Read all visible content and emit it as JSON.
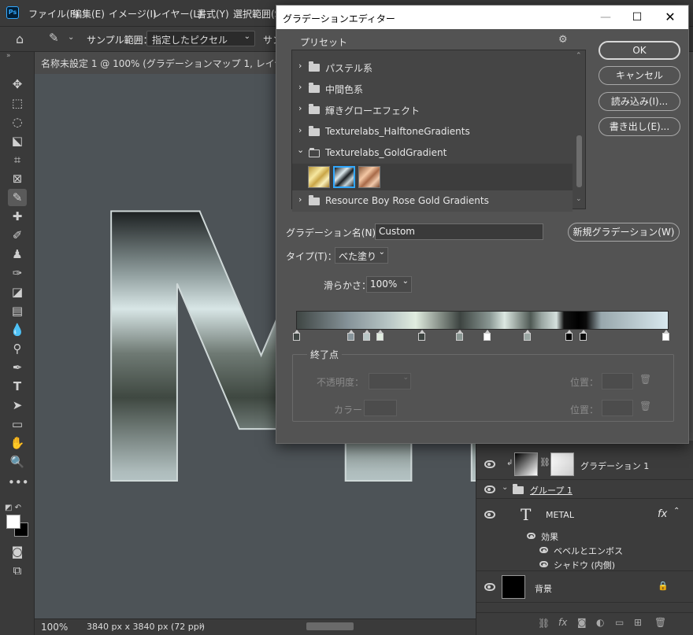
{
  "app": {
    "logo": "Ps",
    "menu": [
      "ファイル(F)",
      "編集(E)",
      "イメージ(I)",
      "レイヤー(L)",
      "書式(Y)",
      "選択範囲(S"
    ]
  },
  "options_bar": {
    "sample_label": "サンプル範囲：",
    "sample_value": "指定したピクセル",
    "trailing": "サン"
  },
  "document": {
    "tab_title": "名称未設定 1 @ 100% (グラデーションマップ 1, レイヤーマスク/16)",
    "canvas_text": "METAL",
    "zoom": "100%",
    "size_info": "3840 px x 3840 px (72 ppi)",
    "status_arrow": "›"
  },
  "dialog": {
    "title": "グラデーションエディター",
    "preset_label": "プリセット",
    "presets": [
      {
        "name": "パステル系",
        "expanded": false
      },
      {
        "name": "中間色系",
        "expanded": false
      },
      {
        "name": "輝きグローエフェクト",
        "expanded": false
      },
      {
        "name": "Texturelabs_HalftoneGradients",
        "expanded": false
      },
      {
        "name": "Texturelabs_GoldGradient",
        "expanded": true
      },
      {
        "name": "Resource Boy Rose Gold Gradients",
        "expanded": false
      }
    ],
    "buttons": {
      "ok": "OK",
      "cancel": "キャンセル",
      "load": "読み込み(I)...",
      "save": "書き出し(E)...",
      "new_gradient": "新規グラデーション(W)"
    },
    "gradient_name_label": "グラデーション名(N)：",
    "gradient_name_value": "Custom",
    "type_label": "タイプ(T)：",
    "type_value": "べた塗り",
    "smoothness_label": "滑らかさ：",
    "smoothness_value": "100%",
    "stops_group_label": "終了点",
    "opacity_label": "不透明度：",
    "color_label": "カラー：",
    "location_label": "位置："
  },
  "layers": {
    "rows": [
      {
        "name": "グラデーション 1"
      },
      {
        "name": "グループ 1"
      },
      {
        "name": "METAL",
        "fx": "fx"
      },
      {
        "name": "効果"
      },
      {
        "name": "ベベルとエンボス"
      },
      {
        "name": "シャドウ (内側)"
      },
      {
        "name": "背景"
      }
    ]
  },
  "colors": {
    "accent": "#31a8ff",
    "canvas_bg": "#4d5357",
    "dialog_bg": "#535353"
  }
}
